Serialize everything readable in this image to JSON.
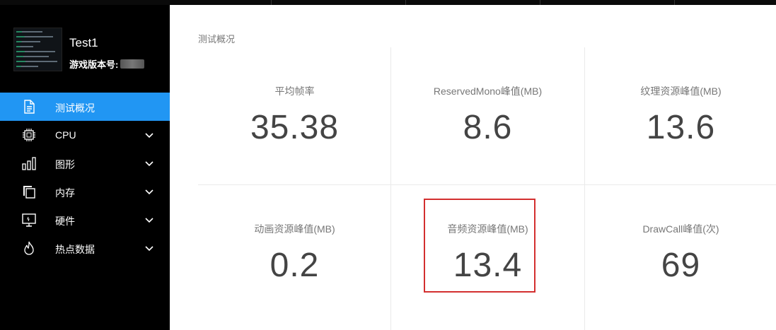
{
  "profile": {
    "name": "Test1",
    "version_label": "游戏版本号:"
  },
  "sidebar": {
    "items": [
      {
        "label": "测试概况",
        "icon": "document-icon",
        "active": true,
        "expandable": false
      },
      {
        "label": "CPU",
        "icon": "cpu-chip-icon",
        "active": false,
        "expandable": true
      },
      {
        "label": "图形",
        "icon": "bar-chart-icon",
        "active": false,
        "expandable": true
      },
      {
        "label": "内存",
        "icon": "memory-copy-icon",
        "active": false,
        "expandable": true
      },
      {
        "label": "硬件",
        "icon": "monitor-icon",
        "active": false,
        "expandable": true
      },
      {
        "label": "热点数据",
        "icon": "flame-icon",
        "active": false,
        "expandable": true
      }
    ]
  },
  "main": {
    "section_title": "测试概况",
    "metrics": [
      {
        "label": "平均帧率",
        "value": "35.38"
      },
      {
        "label": "ReservedMono峰值(MB)",
        "value": "8.6"
      },
      {
        "label": "纹理资源峰值(MB)",
        "value": "13.6"
      },
      {
        "label": "动画资源峰值(MB)",
        "value": "0.2"
      },
      {
        "label": "音频资源峰值(MB)",
        "value": "13.4",
        "highlighted": true
      },
      {
        "label": "DrawCall峰值(次)",
        "value": "69"
      }
    ]
  },
  "colors": {
    "accent": "#2196f3",
    "sidebar_bg": "#000000",
    "highlight_border": "#d32f2f",
    "value_text": "#444444",
    "label_text": "#777777"
  }
}
